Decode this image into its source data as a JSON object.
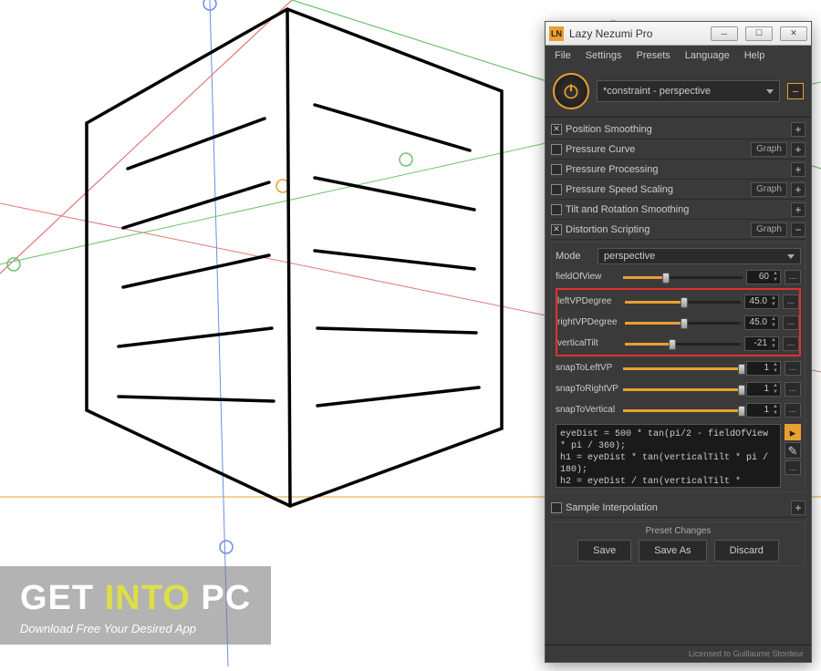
{
  "watermark": {
    "a": "GET",
    "b": "INTO",
    "c": "PC",
    "tagline": "Download Free Your Desired App"
  },
  "window": {
    "title": "Lazy Nezumi Pro",
    "icon_text": "LN",
    "menu": [
      "File",
      "Settings",
      "Presets",
      "Language",
      "Help"
    ],
    "preset_name": "*constraint - perspective",
    "sections": [
      {
        "checked": true,
        "label": "Position Smoothing",
        "graph": false,
        "expanded": false
      },
      {
        "checked": false,
        "label": "Pressure Curve",
        "graph": true,
        "expanded": false
      },
      {
        "checked": false,
        "label": "Pressure Processing",
        "graph": false,
        "expanded": false
      },
      {
        "checked": false,
        "label": "Pressure Speed Scaling",
        "graph": true,
        "expanded": false
      },
      {
        "checked": false,
        "label": "Tilt and Rotation Smoothing",
        "graph": false,
        "expanded": false
      },
      {
        "checked": true,
        "label": "Distortion Scripting",
        "graph": true,
        "expanded": true
      }
    ],
    "mode_label": "Mode",
    "mode_value": "perspective",
    "params": [
      {
        "name": "fieldOfView",
        "value": "60",
        "fill": 35,
        "thumb": 33
      },
      {
        "name": "leftVPDegree",
        "value": "45.0",
        "fill": 50,
        "thumb": 48
      },
      {
        "name": "rightVPDegree",
        "value": "45.0",
        "fill": 50,
        "thumb": 48
      },
      {
        "name": "verticalTilt",
        "value": "-21",
        "fill": 40,
        "thumb": 38
      },
      {
        "name": "snapToLeftVP",
        "value": "1",
        "fill": 100,
        "thumb": 96
      },
      {
        "name": "snapToRightVP",
        "value": "1",
        "fill": 100,
        "thumb": 96
      },
      {
        "name": "snapToVertical",
        "value": "1",
        "fill": 100,
        "thumb": 96
      }
    ],
    "script_text": "eyeDist = 500 * tan(pi/2 - fieldOfView * pi / 360);\nh1 = eyeDist * tan(verticalTilt * pi / 180);\nh2 = eyeDist / tan(verticalTilt *",
    "sample_interp": {
      "checked": false,
      "label": "Sample Interpolation"
    },
    "preset_changes": {
      "header": "Preset Changes",
      "save": "Save",
      "save_as": "Save As",
      "discard": "Discard"
    },
    "graph_label": "Graph",
    "license": "Licensed to Guillaume Stordeur"
  }
}
